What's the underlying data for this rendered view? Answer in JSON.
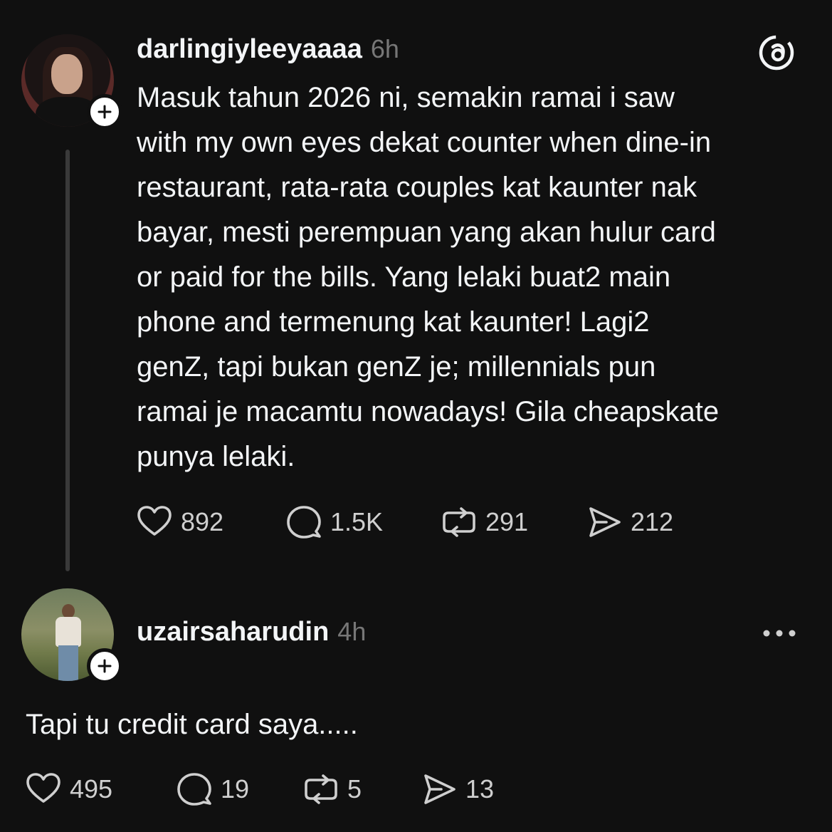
{
  "colors": {
    "background": "#101010",
    "text": "#f3f5f7",
    "muted": "#777777",
    "thread_line": "#3a3a3a"
  },
  "post": {
    "username": "darlingiyleeyaaaa",
    "time": "6h",
    "text": "Masuk tahun 2026 ni, semakin ramai i saw\nwith my own eyes dekat counter when dine-in\nrestaurant, rata-rata couples kat kaunter nak\nbayar, mesti perempuan yang akan hulur card\nor paid for the bills. Yang lelaki buat2 main\nphone and termenung kat kaunter! Lagi2\ngenZ, tapi bukan genZ je; millennials pun\nramai je macamtu nowadays! Gila cheapskate\npunya lelaki.",
    "likes": "892",
    "replies": "1.5K",
    "reposts": "291",
    "shares": "212",
    "app_icon": "threads-logo-icon"
  },
  "reply": {
    "username": "uzairsaharudin",
    "time": "4h",
    "text": "Tapi tu credit card saya.....",
    "likes": "495",
    "replies": "19",
    "reposts": "5",
    "shares": "13",
    "menu_icon": "more-options-icon"
  }
}
